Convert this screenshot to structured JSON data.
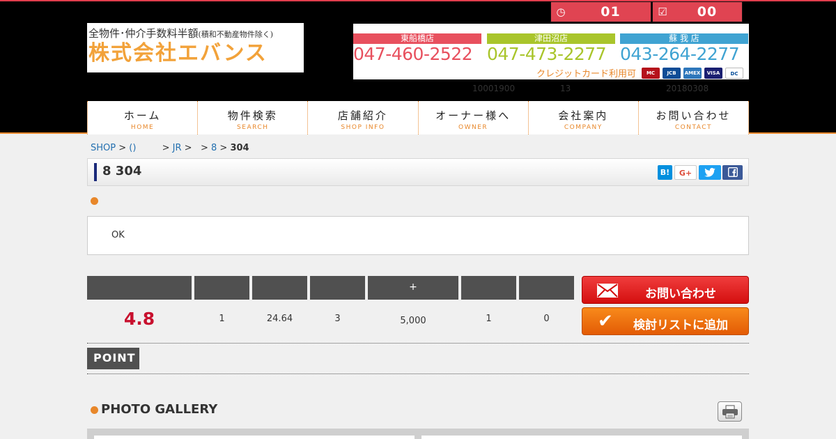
{
  "header": {
    "counter_views": "01",
    "counter_list": "00",
    "logo_sub": "全物件･仲介手数料半額",
    "logo_sub_note": "(積和不動産物件除く)",
    "logo_main": "株式会社エバンス",
    "shops": [
      {
        "name": "東船橋店",
        "tel": "047-460-2522"
      },
      {
        "name": "津田沼店",
        "tel": "047-473-2277"
      },
      {
        "name": "蘇 我 店",
        "tel": "043-264-2277"
      }
    ],
    "cards_text": "クレジットカード利用可",
    "card_labels": [
      "MasterCard",
      "JCB",
      "AMEX",
      "VISA",
      "Diners"
    ],
    "meta": [
      "10001900",
      "13",
      "20180308"
    ]
  },
  "nav": [
    {
      "jp": "ホーム",
      "en": "HOME"
    },
    {
      "jp": "物件検索",
      "en": "SEARCH"
    },
    {
      "jp": "店舗紹介",
      "en": "SHOP INFO"
    },
    {
      "jp": "オーナー様へ",
      "en": "OWNER"
    },
    {
      "jp": "会社案内",
      "en": "COMPANY"
    },
    {
      "jp": "お問い合わせ",
      "en": "CONTACT"
    }
  ],
  "breadcrumb": {
    "shop": "SHOP",
    "sep1": " > ",
    "area": "()",
    "sep2": "         > ",
    "line": "JR",
    "sep3": " >   > ",
    "num": "8",
    "sep4": " > ",
    "current": "304"
  },
  "title": "8 304",
  "note": "OK",
  "table": {
    "headers": [
      "",
      "",
      "",
      "",
      "+",
      "",
      ""
    ],
    "values": [
      "4.8",
      "1",
      "24.64",
      "3",
      "5,000",
      "1",
      "0"
    ]
  },
  "buttons": {
    "contact": "お問い合わせ",
    "add_list": "検討リストに追加"
  },
  "share": {
    "hatena": "B!",
    "gplus": "G+"
  },
  "point_label": "POINT",
  "gallery_title": "PHOTO GALLERY",
  "colors": {
    "accent_orange": "#e8872a",
    "price_red": "#c8102e",
    "shop1": "#e8505e",
    "shop2": "#a9c52b",
    "shop3": "#3fa3d2"
  }
}
